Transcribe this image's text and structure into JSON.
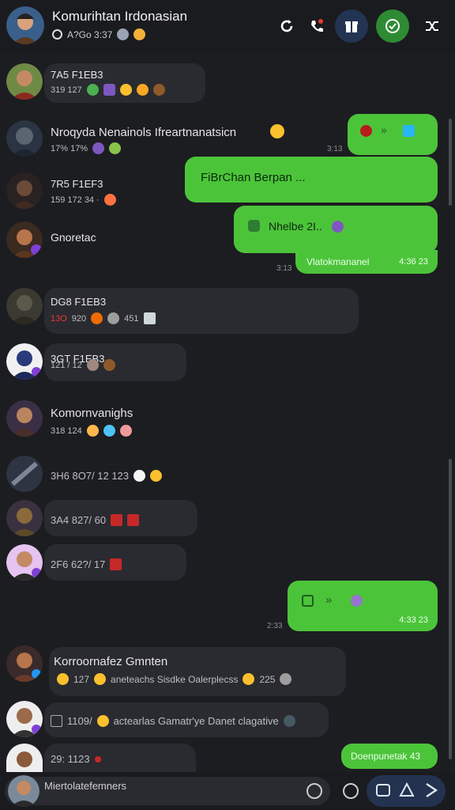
{
  "header": {
    "title": "Komurihtan Irdonasian",
    "subtitle": "A?Go 3:37",
    "icons": [
      "refresh-icon",
      "phone-icon",
      "gift-icon",
      "check-circle-icon",
      "shuffle-icon"
    ],
    "accent": "#4cc43a"
  },
  "messages": [
    {
      "type": "in",
      "name": "7A5 F1EB3",
      "meta": "319 127"
    },
    {
      "type": "in",
      "name": "Nroqyda Nenainols Ifreartnanatsicn",
      "meta": "17% 17%"
    },
    {
      "type": "in",
      "name": "7R5 F1EF3",
      "meta": "159 172 34 ·"
    },
    {
      "type": "in",
      "name": "Gnoretac",
      "meta": ""
    },
    {
      "type": "in",
      "name": "DG8 F1EB3",
      "meta_a": "13O",
      "meta_b": "920",
      "meta_c": "451"
    },
    {
      "type": "in",
      "name": "3GT F1EB3",
      "meta": "121 / 12"
    },
    {
      "type": "in",
      "name": "Komornvanighs",
      "meta": "318 124"
    },
    {
      "type": "in",
      "name": "",
      "meta": "3H6 8O7/ 12 123"
    },
    {
      "type": "in",
      "name": "",
      "meta": "3A4 827/ 60"
    },
    {
      "type": "in",
      "name": "",
      "meta": "2F6 62?/ 17"
    },
    {
      "type": "in",
      "name": "Korroornafez Gmnten",
      "meta_a": "127",
      "meta_b": "aneteachs Sisdke Oalerplecss",
      "meta_c": "225"
    },
    {
      "type": "in",
      "name": "",
      "meta_a": "1109/",
      "meta_b": "actearlas Gamatr'ye Danet clagative"
    },
    {
      "type": "in",
      "name": "",
      "meta": "29: 1123"
    }
  ],
  "outgoing": [
    {
      "text": "",
      "time": "3:13"
    },
    {
      "text": "FiBrChan Berpan ...",
      "time": ""
    },
    {
      "text": "Nhelbe 2I..",
      "time": "3:13"
    },
    {
      "text": "Vlatokmananel",
      "time": "4:36 23"
    },
    {
      "text": "",
      "time": "4:33 23"
    },
    {
      "text": "Doenpunetak 43",
      "time": ""
    }
  ],
  "stamps": [
    "3:13",
    "3:13",
    "2:33"
  ],
  "composer": {
    "placeholder": "Miertolatefemners",
    "icons": [
      "emoji-icon",
      "sticker-icon",
      "camera-icon",
      "attach-icon",
      "send-icon"
    ]
  }
}
